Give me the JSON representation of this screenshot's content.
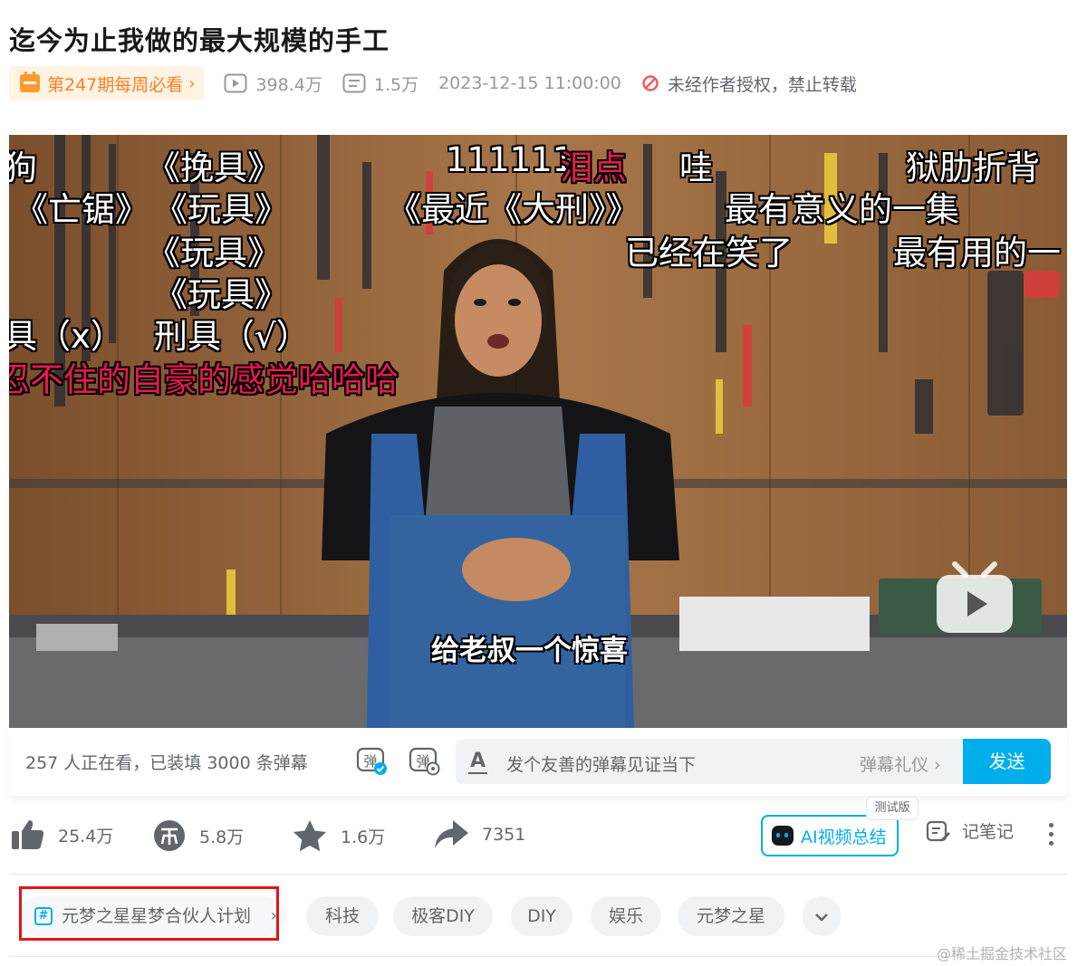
{
  "video": {
    "title": "迄今为止我做的最大规模的手工"
  },
  "meta": {
    "weekly_badge": "第247期每周必看",
    "weekly_chevron": "›",
    "plays": "398.4万",
    "danmaku_count": "1.5万",
    "publish_time": "2023-12-15 11:00:00",
    "copyright": "未经作者授权，禁止转载"
  },
  "player": {
    "subtitle": "给老叔一个惊喜",
    "danmaku": [
      {
        "text": "狗",
        "red": false
      },
      {
        "text": "《挽具》",
        "red": false
      },
      {
        "text": "111111",
        "red": false
      },
      {
        "text": "泪点",
        "red": true
      },
      {
        "text": "哇",
        "red": false
      },
      {
        "text": "狱肋折背",
        "red": false
      },
      {
        "text": "《亡锯》",
        "red": false
      },
      {
        "text": "《玩具》",
        "red": false
      },
      {
        "text": "《最近《大刑》》",
        "red": false
      },
      {
        "text": "最有意义的一集",
        "red": false
      },
      {
        "text": "《玩具》",
        "red": false
      },
      {
        "text": "已经在笑了",
        "red": false
      },
      {
        "text": "最有用的一",
        "red": false
      },
      {
        "text": "《玩具》",
        "red": false
      },
      {
        "text": "具（x）",
        "red": false
      },
      {
        "text": "刑具（√）",
        "red": false
      },
      {
        "text": "忍不住的自豪的感觉哈哈哈",
        "red": true
      }
    ]
  },
  "danmaku_bar": {
    "watching": "257 人正在看，已装填 3000 条弹幕",
    "input_placeholder": "发个友善的弹幕见证当下",
    "etiquette": "弹幕礼仪 ›",
    "send": "发送"
  },
  "actions": {
    "like": "25.4万",
    "coin": "5.8万",
    "favorite": "1.6万",
    "share": "7351",
    "ai_summary": "AI视频总结",
    "beta": "测试版",
    "notes": "记笔记"
  },
  "tags": [
    {
      "label": "元梦之星星梦合伙人计划",
      "chevron": "›"
    },
    {
      "label": "科技"
    },
    {
      "label": "极客DIY"
    },
    {
      "label": "DIY"
    },
    {
      "label": "娱乐"
    },
    {
      "label": "元梦之星"
    }
  ],
  "watermark": "@稀土掘金技术社区",
  "colors": {
    "accent": "#00aeec",
    "weekly": "#ff7f24",
    "highlight_box": "#e31515",
    "danmaku_red": "#e8194e"
  }
}
